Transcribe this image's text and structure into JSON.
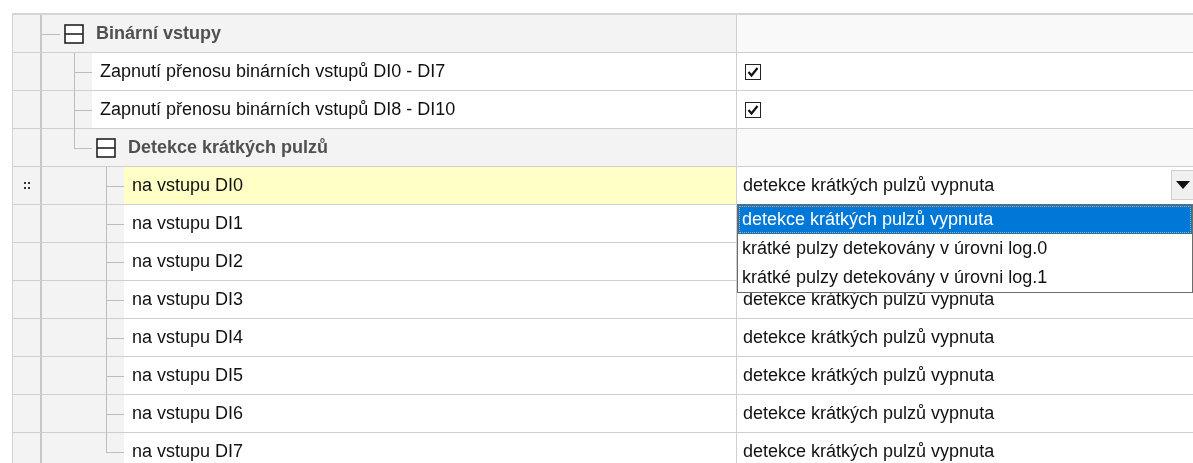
{
  "tree": [
    {
      "kind": "group",
      "label": "Binární vstupy",
      "expanded": true,
      "children": [
        {
          "kind": "checkbox",
          "label": "Zapnutí přenosu binárních vstupů DI0 - DI7",
          "checked": true
        },
        {
          "kind": "checkbox",
          "label": "Zapnutí přenosu binárních vstupů DI8 - DI10",
          "checked": true
        },
        {
          "kind": "group",
          "label": "Detekce krátkých pulzů",
          "expanded": true,
          "children": [
            {
              "kind": "choice",
              "label": "na vstupu DI0",
              "selected": true,
              "value": "detekce krátkých pulzů vypnuta",
              "dropdown": {
                "open": true,
                "options": [
                  {
                    "label": "detekce krátkých pulzů vypnuta",
                    "selected": true
                  },
                  {
                    "label": "krátké pulzy detekovány v úrovni log.0",
                    "selected": false
                  },
                  {
                    "label": "krátké pulzy detekovány v úrovni log.1",
                    "selected": false
                  }
                ]
              }
            },
            {
              "kind": "choice",
              "label": "na vstupu DI1",
              "selected": false
            },
            {
              "kind": "choice",
              "label": "na vstupu DI2",
              "selected": false
            },
            {
              "kind": "choice",
              "label": "na vstupu DI3",
              "selected": false,
              "value": "detekce krátkých pulzů vypnuta"
            },
            {
              "kind": "choice",
              "label": "na vstupu DI4",
              "selected": false,
              "value": "detekce krátkých pulzů vypnuta"
            },
            {
              "kind": "choice",
              "label": "na vstupu DI5",
              "selected": false,
              "value": "detekce krátkých pulzů vypnuta"
            },
            {
              "kind": "choice",
              "label": "na vstupu DI6",
              "selected": false,
              "value": "detekce krátkých pulzů vypnuta"
            },
            {
              "kind": "choice",
              "label": "na vstupu DI7",
              "selected": false,
              "value": "detekce krátkých pulzů vypnuta"
            }
          ]
        }
      ]
    }
  ]
}
